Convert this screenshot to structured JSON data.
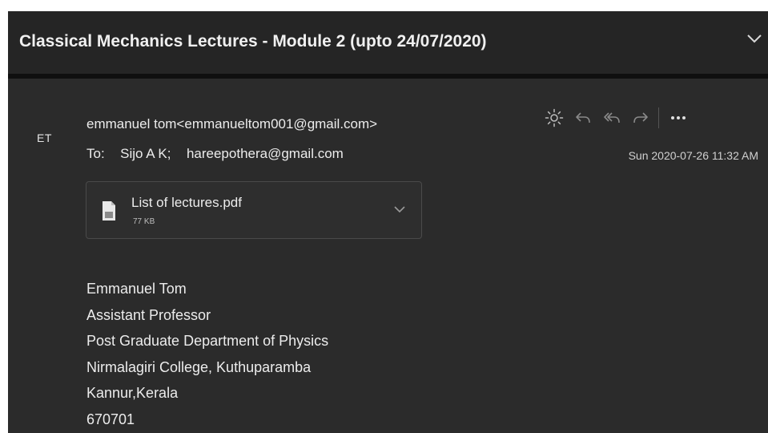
{
  "message": {
    "subject": "Classical Mechanics Lectures - Module 2 (upto 24/07/2020)",
    "avatar_initials": "ET",
    "sender": "emmanuel tom<emmanueltom001@gmail.com>",
    "to_label": "To:",
    "recipients": [
      "Sijo A K;",
      "hareepothera@gmail.com"
    ],
    "timestamp": "Sun 2020-07-26 11:32 AM",
    "toolbar_icons": [
      "sun-icon",
      "reply-icon",
      "reply-all-icon",
      "forward-icon",
      "more-icon"
    ],
    "attachment": {
      "name": "List of lectures.pdf",
      "size": "77 KB"
    },
    "signature": [
      "Emmanuel Tom",
      "Assistant Professor",
      "Post Graduate Department of Physics",
      "Nirmalagiri College, Kuthuparamba",
      "Kannur,Kerala",
      "670701"
    ]
  },
  "colors": {
    "background": "#2b2b2b",
    "header": "#252525",
    "text": "#ececec",
    "border": "#4a4a4a"
  }
}
